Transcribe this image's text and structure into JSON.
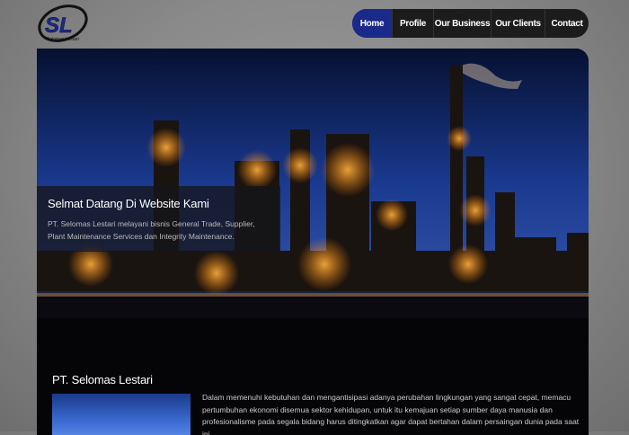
{
  "logo": {
    "text": "SL",
    "subtext": "Selomas Lestari"
  },
  "nav": {
    "items": [
      {
        "label": "Home",
        "active": true
      },
      {
        "label": "Profile"
      },
      {
        "label": "Our Business"
      },
      {
        "label": "Our Clients"
      },
      {
        "label": "Contact"
      }
    ],
    "active_color": "#1a2a8a"
  },
  "hero": {
    "title": "Selmat Datang Di Website Kami",
    "text": "PT. Selomas Lestari melayani bisnis General Trade, Supplier, Plant Maintenance Services dan Integrity Maintenance."
  },
  "section": {
    "title": "PT. Selomas Lestari",
    "text": "Dalam memenuhi kebutuhan dan mengantisipasi adanya perubahan lingkungan yang sangat cepat, memacu pertumbuhan ekonomi disemua sektor kehidupan, untuk itu kemajuan setiap sumber daya manusia dan profesionalisme pada segala bidang harus ditingkatkan agar dapat bertahan dalam persaingan dunia pada saat ini."
  }
}
